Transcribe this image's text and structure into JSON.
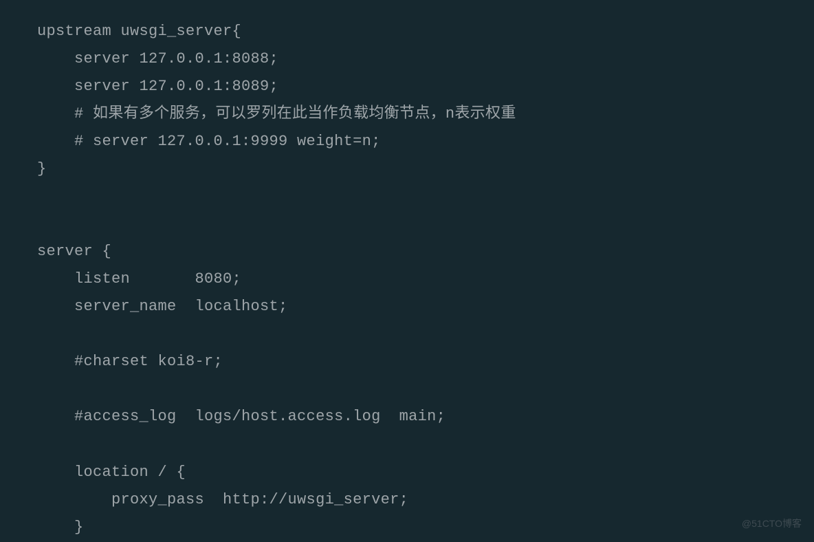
{
  "code": {
    "line1": "upstream uwsgi_server{",
    "line2": "    server 127.0.0.1:8088;",
    "line3": "    server 127.0.0.1:8089;",
    "line4": "    # 如果有多个服务，可以罗列在此当作负载均衡节点，n表示权重",
    "line5": "    # server 127.0.0.1:9999 weight=n;",
    "line6": "}",
    "line7": "",
    "line8": "",
    "line9": "server {",
    "line10": "    listen       8080;",
    "line11": "    server_name  localhost;",
    "line12": "",
    "line13": "    #charset koi8-r;",
    "line14": "",
    "line15": "    #access_log  logs/host.access.log  main;",
    "line16": "",
    "line17": "    location / {",
    "line18": "        proxy_pass  http://uwsgi_server;",
    "line19": "    }"
  },
  "watermark": "@51CTO博客"
}
